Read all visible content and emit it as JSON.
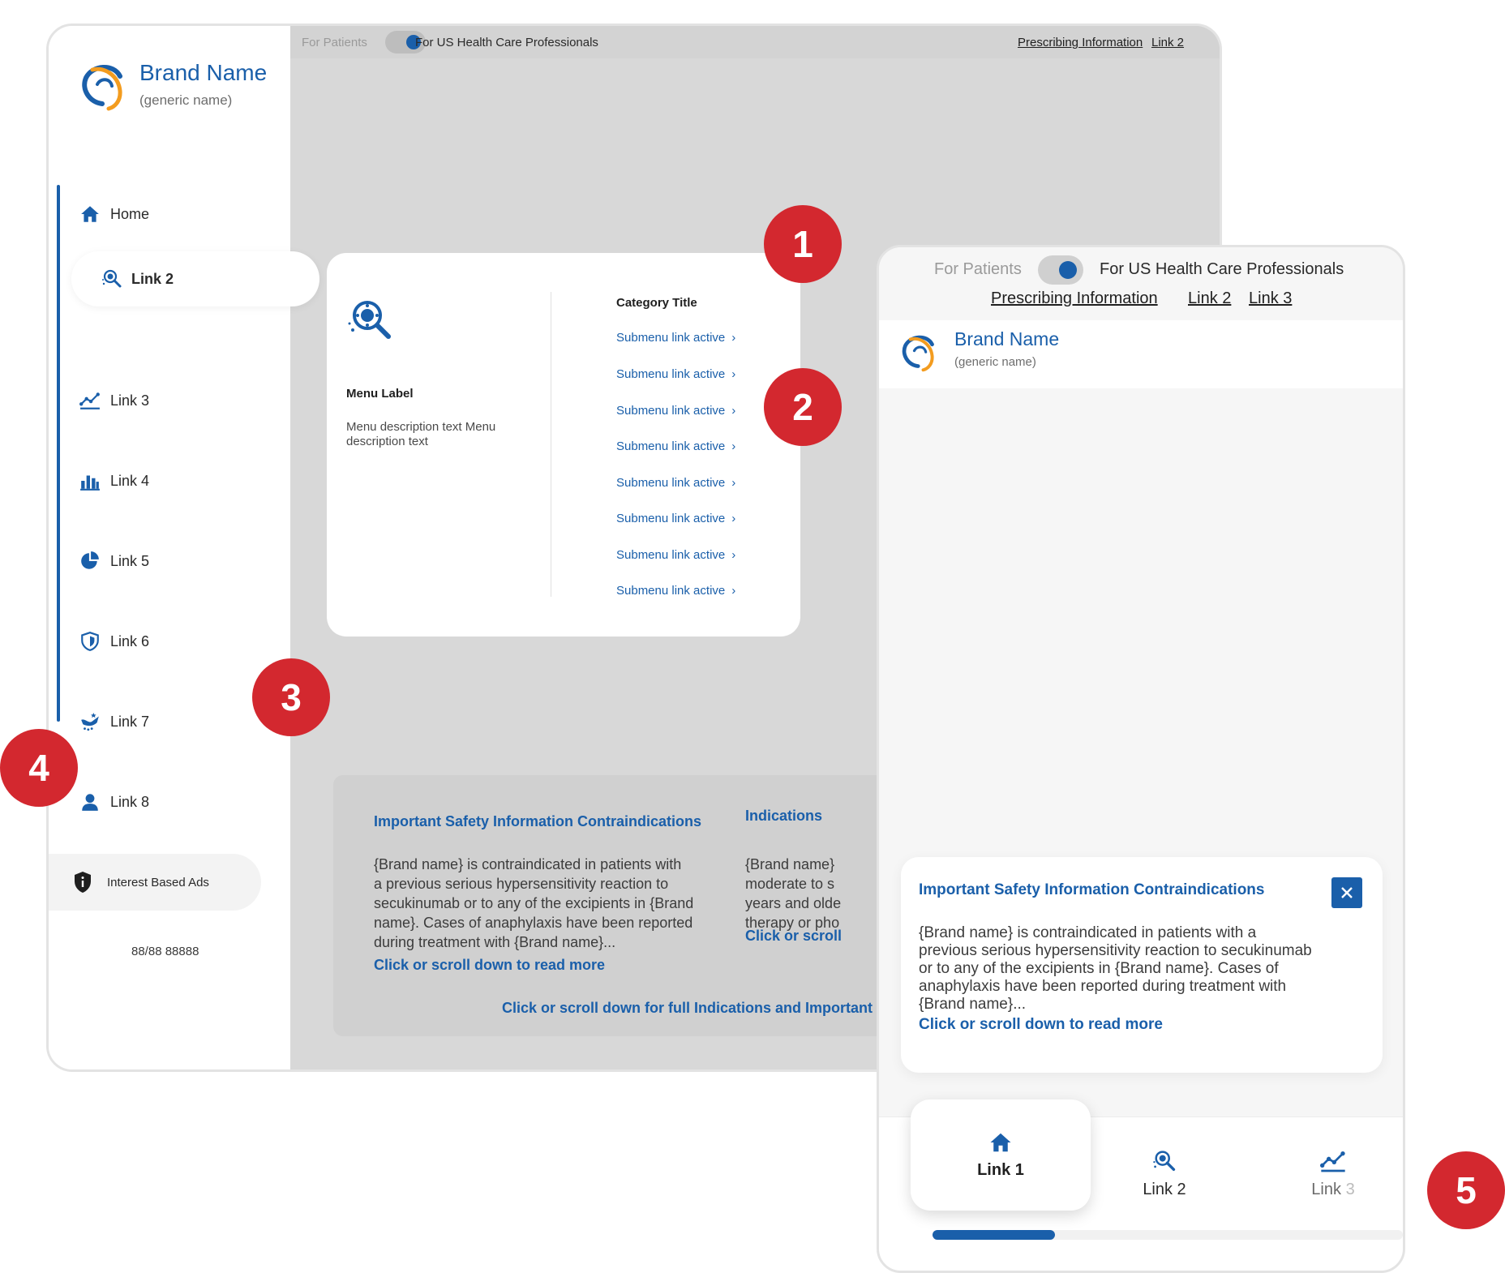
{
  "desktop": {
    "topbar": {
      "for_patients": "For Patients",
      "for_hcp": "For US Health Care Professionals",
      "links": [
        "Prescribing Information",
        "Link 2"
      ]
    },
    "brand": {
      "name": "Brand Name",
      "generic": "(generic name)"
    },
    "nav": {
      "items": [
        {
          "label": "Home",
          "icon": "home-icon"
        },
        {
          "label": "Link 2",
          "icon": "magnify-virus-icon",
          "active": true
        },
        {
          "label": "Link 3",
          "icon": "trend-line-icon"
        },
        {
          "label": "Link 4",
          "icon": "bar-chart-icon"
        },
        {
          "label": "Link 5",
          "icon": "pie-chart-icon"
        },
        {
          "label": "Link 6",
          "icon": "shield-icon"
        },
        {
          "label": "Link 7",
          "icon": "hand-stars-icon"
        },
        {
          "label": "Link 8",
          "icon": "person-icon"
        }
      ]
    },
    "ads_label": "Interest Based Ads",
    "phone": "88/88 88888",
    "menu": {
      "label": "Menu Label",
      "description": "Menu description text Menu description text",
      "category_title": "Category Title",
      "submenu": [
        "Submenu link active",
        "Submenu link active",
        "Submenu link active",
        "Submenu link active",
        "Submenu link active",
        "Submenu link active",
        "Submenu link active",
        "Submenu link active"
      ]
    },
    "isi": {
      "contra_title": "Important Safety Information Contraindications",
      "contra_lines": [
        "{Brand name} is contraindicated in patients with",
        "a previous serious hypersensitivity reaction to",
        "secukinumab or to any of the excipients in {Brand",
        "name}. Cases of anaphylaxis have been reported",
        "during treatment with {Brand name}..."
      ],
      "read_more": "Click or scroll down to read more",
      "indications_title": "Indications",
      "indications_lines": [
        "{Brand name}",
        "moderate to s",
        "years and olde",
        "therapy or pho"
      ],
      "indications_more": "Click or scroll",
      "full_link": "Click or scroll down for full Indications and Important"
    }
  },
  "mobile": {
    "topbar": {
      "for_patients": "For Patients",
      "for_hcp": "For US Health Care Professionals",
      "links": [
        "Prescribing Information",
        "Link 2",
        "Link 3"
      ]
    },
    "brand": {
      "name": "Brand Name",
      "generic": "(generic name)"
    },
    "isi": {
      "title": "Important Safety Information Contraindications",
      "lines": [
        "{Brand name} is contraindicated in patients with a",
        "previous serious hypersensitivity reaction to secukinumab",
        "or to any of the excipients in {Brand name}. Cases of",
        "anaphylaxis have been reported during treatment with",
        "{Brand name}..."
      ],
      "read_more": "Click or scroll down to read more"
    },
    "bottom_nav": {
      "items": [
        {
          "label": "Link 1",
          "icon": "home-icon",
          "active": true
        },
        {
          "label": "Link 2",
          "icon": "magnify-virus-icon"
        },
        {
          "label": "Link",
          "suffix": "3",
          "icon": "trend-line-icon"
        }
      ],
      "scroll_progress": 0.26
    }
  },
  "callouts": [
    "1",
    "2",
    "3",
    "4",
    "5"
  ],
  "colors": {
    "brand_blue": "#1a5faa",
    "callout_red": "#d3282f",
    "logo_orange": "#f39c1f"
  }
}
